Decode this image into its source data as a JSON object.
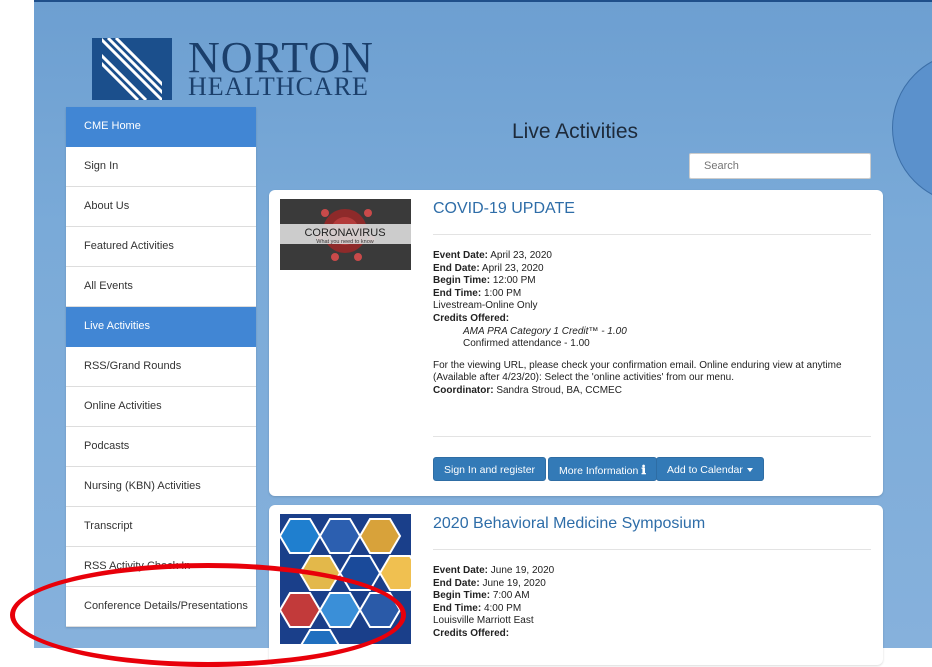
{
  "brand": {
    "line1": "NORTON",
    "line2": "HEALTHCARE"
  },
  "page_title": "Live Activities",
  "search": {
    "placeholder": "Search"
  },
  "sidebar": {
    "items": [
      {
        "label": "CME Home",
        "active": true
      },
      {
        "label": "Sign In"
      },
      {
        "label": "About Us"
      },
      {
        "label": "Featured Activities"
      },
      {
        "label": "All Events"
      },
      {
        "label": "Live Activities",
        "active": true
      },
      {
        "label": "RSS/Grand Rounds"
      },
      {
        "label": "Online Activities"
      },
      {
        "label": "Podcasts"
      },
      {
        "label": "Nursing (KBN) Activities"
      },
      {
        "label": "Transcript"
      },
      {
        "label": "RSS Activity Check In"
      },
      {
        "label": "Conference Details/Presentations"
      }
    ]
  },
  "events": [
    {
      "title": "COVID-19 UPDATE",
      "thumb_text1": "CORONAVIRUS",
      "thumb_text2": "What you need to know",
      "event_date_label": "Event Date:",
      "event_date": "April 23, 2020",
      "end_date_label": "End Date:",
      "end_date": "April 23, 2020",
      "begin_time_label": "Begin Time:",
      "begin_time": "12:00 PM",
      "end_time_label": "End Time:",
      "end_time": "1:00 PM",
      "location": "Livestream-Online Only",
      "credits_label": "Credits Offered:",
      "credit1": "AMA PRA Category 1 Credit™ - 1.00",
      "credit2": "Confirmed attendance - 1.00",
      "note": "For the viewing URL, please check your confirmation email. Online enduring view at anytime (Available after 4/23/20): Select the 'online activities' from our menu.",
      "coordinator_label": "Coordinator:",
      "coordinator": "Sandra Stroud, BA, CCMEC",
      "buttons": {
        "register": "Sign In and register",
        "more_info": "More Information",
        "calendar": "Add to Calendar"
      }
    },
    {
      "title": "2020 Behavioral Medicine Symposium",
      "event_date_label": "Event Date:",
      "event_date": "June 19, 2020",
      "end_date_label": "End Date:",
      "end_date": "June 19, 2020",
      "begin_time_label": "Begin Time:",
      "begin_time": "7:00 AM",
      "end_time_label": "End Time:",
      "end_time": "4:00 PM",
      "location": "Louisville Marriott East",
      "credits_label": "Credits Offered:"
    }
  ],
  "colors": {
    "accent": "#4186d4",
    "link": "#2e6da8",
    "button": "#337ab7",
    "annotation": "#e8000a"
  }
}
